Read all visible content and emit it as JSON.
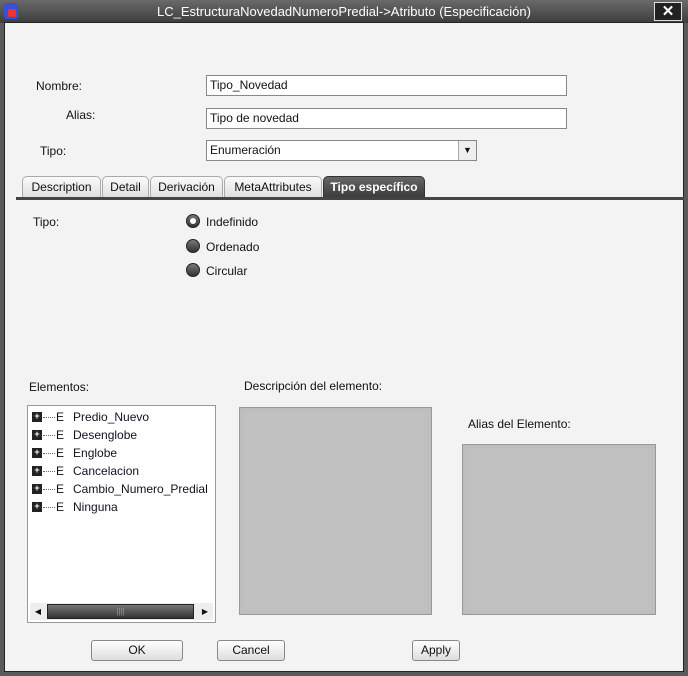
{
  "window": {
    "title": "LC_EstructuraNovedadNumeroPredial->Atributo (Especificación)",
    "close": "✕"
  },
  "form": {
    "nombre_label": "Nombre:",
    "nombre_value": "Tipo_Novedad",
    "alias_label": "Alias:",
    "alias_value": "Tipo de novedad",
    "tipo_label": "Tipo:",
    "tipo_value": "Enumeración"
  },
  "tabs": [
    {
      "label": "Description"
    },
    {
      "label": "Detail"
    },
    {
      "label": "Derivación"
    },
    {
      "label": "MetaAttributes"
    },
    {
      "label": "Tipo específico",
      "active": true
    }
  ],
  "tipo_especifico": {
    "tipo_label": "Tipo:",
    "options": [
      {
        "label": "Indefinido",
        "selected": true
      },
      {
        "label": "Ordenado"
      },
      {
        "label": "Circular"
      }
    ],
    "elementos_label": "Elementos:",
    "elements": [
      {
        "prefix": "E",
        "label": "Predio_Nuevo"
      },
      {
        "prefix": "E",
        "label": "Desenglobe"
      },
      {
        "prefix": "E",
        "label": "Englobe"
      },
      {
        "prefix": "E",
        "label": "Cancelacion"
      },
      {
        "prefix": "E",
        "label": "Cambio_Numero_Predial"
      },
      {
        "prefix": "E",
        "label": "Ninguna"
      }
    ],
    "descripcion_label": "Descripción del elemento:",
    "alias_elemento_label": "Alias del Elemento:"
  },
  "buttons": {
    "ok": "OK",
    "cancel": "Cancel",
    "apply": "Apply"
  }
}
